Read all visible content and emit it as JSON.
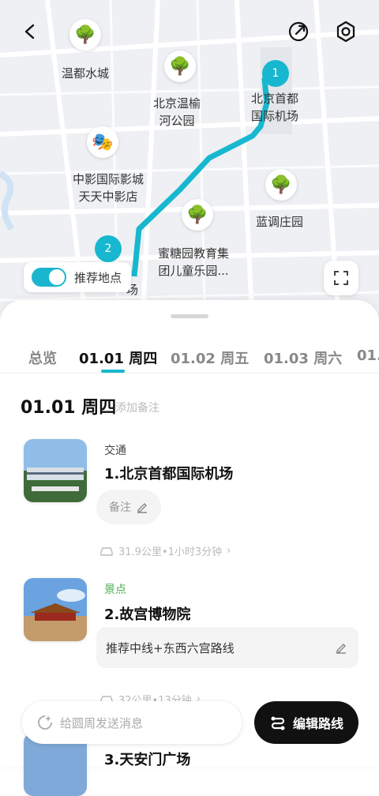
{
  "map": {
    "pois": [
      {
        "name": "温都水城",
        "icon": "tree-icon"
      },
      {
        "name": "北京温榆\n河公园",
        "icon": "tree-icon"
      },
      {
        "name": "北京首都\n国际机场",
        "icon": "pin"
      },
      {
        "name": "中影国际影城\n天天中影店",
        "icon": "theater-icon"
      },
      {
        "name": "蓝调庄园",
        "icon": "tree-icon"
      },
      {
        "name": "蜜糖园教育集\n团儿童乐园...",
        "icon": "tree-icon"
      }
    ],
    "pin_labels": [
      "1",
      "2"
    ],
    "partial_label": "场",
    "toggle_label": "推荐地点"
  },
  "tabs": [
    "总览",
    "01.01 周四",
    "01.02 周五",
    "01.03 周六",
    "01.0"
  ],
  "day": {
    "title": "01.01 周四",
    "add_note": "添加备注"
  },
  "items": [
    {
      "category": "交通",
      "title": "1.北京首都国际机场",
      "note": "备注",
      "travel": "31.9公里•1小时3分钟"
    },
    {
      "category": "景点",
      "title": "2.故宫博物院",
      "route": "推荐中线+东西六宫路线",
      "travel": "32公里•13分钟"
    },
    {
      "title": "3.天安门广场"
    }
  ],
  "bottom": {
    "message_placeholder": "给圆周发送消息",
    "edit_label": "编辑路线"
  },
  "colors": {
    "accent": "#17b8cf",
    "green": "#4caf50"
  }
}
